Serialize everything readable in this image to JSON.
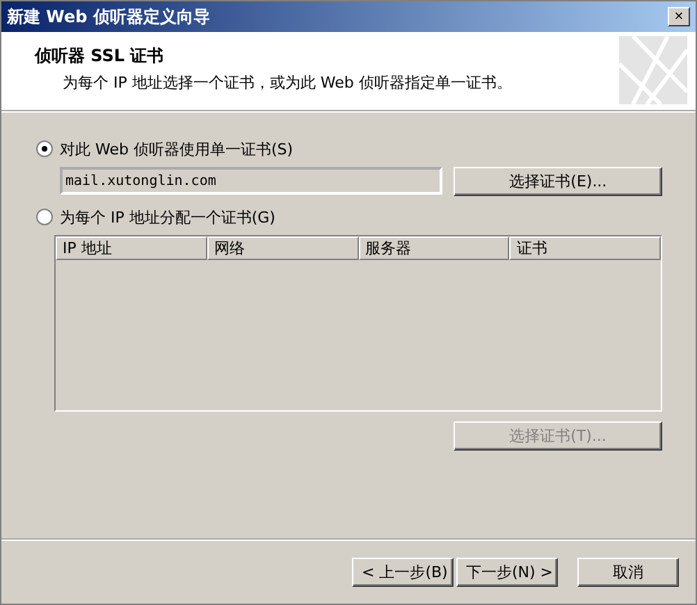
{
  "window": {
    "title": "新建 Web 侦听器定义向导",
    "close": "×"
  },
  "header": {
    "title": "侦听器 SSL 证书",
    "subtitle": "为每个 IP 地址选择一个证书，或为此 Web 侦听器指定单一证书。"
  },
  "options": [
    {
      "label": "对此 Web 侦听器使用单一证书(S)",
      "selected": true
    },
    {
      "label": "为每个 IP 地址分配一个证书(G)",
      "selected": false
    }
  ],
  "certificate_field": {
    "value": "mail.xutonglin.com"
  },
  "select_certificate_button": {
    "label": "选择证书(E)...",
    "disabled": false
  },
  "table": {
    "columns": [
      "IP 地址",
      "网络",
      "服务器",
      "证书"
    ]
  },
  "table_select_button": {
    "label": "选择证书(T)...",
    "disabled": true
  },
  "footer_buttons": [
    "< 上一步(B)",
    "下一步(N) >",
    "取消"
  ]
}
